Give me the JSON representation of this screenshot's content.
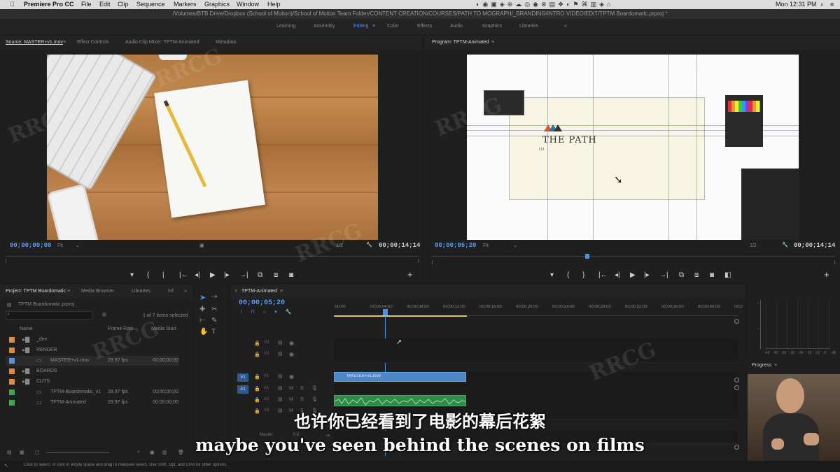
{
  "menubar": {
    "app_name": "Premiere Pro CC",
    "items": [
      "File",
      "Edit",
      "Clip",
      "Sequence",
      "Markers",
      "Graphics",
      "Window",
      "Help"
    ],
    "clock": "Mon 12:31 PM"
  },
  "path_title": "/Volumes/BTB Drive/Dropbox (School of Motion)/School of Motion Team Folder/CONTENT CREATION/COURSES/PATH TO MOGRAPH/_BRANDING/INTRO VIDEO/EDIT/TPTM Boardomatic.prproj *",
  "workspaces": [
    "Learning",
    "Assembly",
    "Editing",
    "Color",
    "Effects",
    "Audio",
    "Graphics",
    "Libraries"
  ],
  "active_workspace": "Editing",
  "source_panel": {
    "tabs": [
      "Source: MASTER+v1.mov",
      "Effect Controls",
      "Audio Clip Mixer: TPTM-Animated",
      "Metadata"
    ],
    "timecode_in": "00;00;00;00",
    "fit": "Fit",
    "resolution": "1/2",
    "timecode_dur": "00;00;14;14"
  },
  "program_panel": {
    "tabs": [
      "Program: TPTM-Animated"
    ],
    "timecode_in": "00;00;05;20",
    "fit": "Fit",
    "resolution": "1/2",
    "timecode_dur": "00;00;14;14",
    "logo_text": "THE PATH",
    "logo_sub": "TO"
  },
  "project_panel": {
    "tabs": [
      "Project: TPTM Boardomatic",
      "Media Browser",
      "Libraries",
      "Inf"
    ],
    "project_file": "TPTM Boardomatic.prproj",
    "selection_info": "1 of 7 items selected",
    "columns": [
      "Name",
      "Frame Rate",
      "Media Start"
    ],
    "rows": [
      {
        "name": "_dev",
        "frame": "",
        "start": "",
        "color": "#e08a3c"
      },
      {
        "name": "RENDER",
        "frame": "",
        "start": "",
        "color": "#e08a3c"
      },
      {
        "name": "MASTER+v1.mov",
        "frame": "29.97 fps",
        "start": "00;00;00;00",
        "color": "#5b8fd8"
      },
      {
        "name": "BOARDS",
        "frame": "",
        "start": "",
        "color": "#e08a3c"
      },
      {
        "name": "CUTS",
        "frame": "",
        "start": "",
        "color": "#e08a3c"
      },
      {
        "name": "TPTM-Boardomatic_v1",
        "frame": "29.97 fps",
        "start": "00;00;00;00",
        "color": "#3ea84f"
      },
      {
        "name": "TPTM-Animated",
        "frame": "29.97 fps",
        "start": "00;00;00;00",
        "color": "#3ea84f"
      }
    ]
  },
  "timeline": {
    "tab": "TPTM-Animated",
    "timecode": "00;00;05;20",
    "ruler": [
      ":00;00",
      "00;00;04;00",
      "00;00;08;00",
      "00;00;12;00",
      "00;00;16;00",
      "00;00;20;00",
      "00;00;24;00",
      "00;00;28;00",
      "00;00;32;00",
      "00;00;36;00",
      "00;00;40;00",
      "00;0"
    ],
    "tracks": [
      "V3",
      "V2",
      "V1",
      "A1",
      "A2",
      "A3",
      "Master"
    ],
    "master_value": "0.0",
    "video_clip": "MASTER+v1.mov"
  },
  "meter_labels": [
    "-48",
    "-42",
    "-36",
    "-30",
    "-24",
    "-18",
    "-12",
    "-6",
    "dB"
  ],
  "progress_panel": {
    "title": "Progress"
  },
  "status_bar": "Click to select, or click in empty space and drag to marquee select. Use Shift, Opt, and Cmd for other options.",
  "subtitles": {
    "cn": "也许你已经看到了电影的幕后花絮",
    "en": "maybe you've seen behind the scenes on films"
  },
  "watermark": "RRCG",
  "colors": {
    "accent": "#4a90e2",
    "timecode": "#5b9bff",
    "audio_clip": "#2f8a4b",
    "video_clip": "#4d86c6"
  }
}
